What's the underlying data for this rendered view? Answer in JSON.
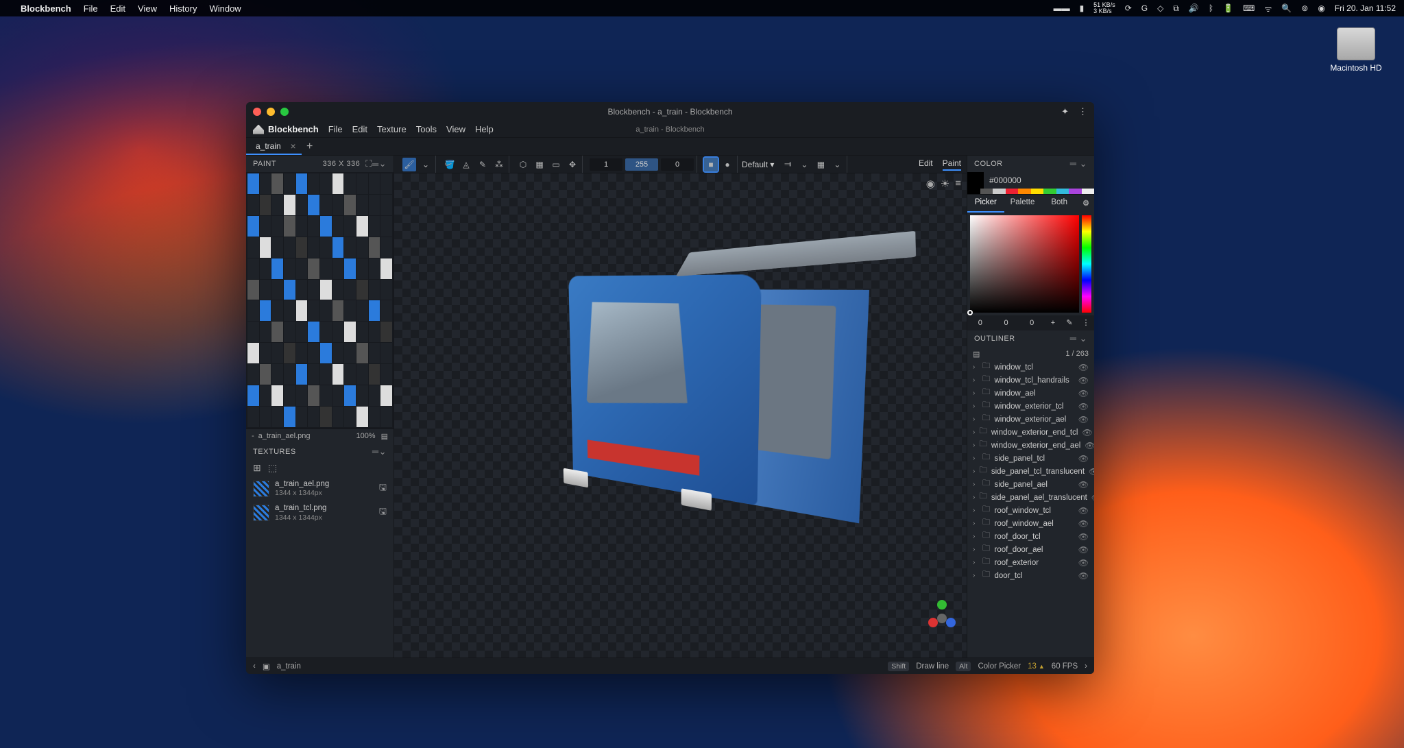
{
  "macos": {
    "app": "Blockbench",
    "menus": [
      "File",
      "Edit",
      "View",
      "History",
      "Window"
    ],
    "right_stats": {
      "net_up": "51 KB/s",
      "net_down": "3 KB/s"
    },
    "clock": "Fri 20. Jan  11:52"
  },
  "desktop_items": {
    "hd": "Macintosh HD"
  },
  "window": {
    "title": "Blockbench - a_train - Blockbench",
    "subtitle": "a_train - Blockbench",
    "menus": [
      "File",
      "Edit",
      "Texture",
      "Tools",
      "View",
      "Help"
    ]
  },
  "tabs": {
    "active": "a_train"
  },
  "paint_panel": {
    "title": "PAINT",
    "dimensions": "336 x 336",
    "uv_file": "a_train_ael.png",
    "zoom": "100%"
  },
  "textures": {
    "title": "TEXTURES",
    "items": [
      {
        "name": "a_train_ael.png",
        "dim": "1344 x 1344px"
      },
      {
        "name": "a_train_tcl.png",
        "dim": "1344 x 1344px"
      }
    ]
  },
  "toolbar": {
    "brush_vals": [
      "1",
      "255",
      "0"
    ],
    "shading": "Default"
  },
  "mode_tabs": {
    "edit": "Edit",
    "paint": "Paint"
  },
  "color_panel": {
    "title": "COLOR",
    "hex": "#000000",
    "tabs": [
      "Picker",
      "Palette",
      "Both"
    ],
    "rgb": [
      "0",
      "0",
      "0"
    ]
  },
  "outliner": {
    "title": "OUTLINER",
    "count": "1 / 263",
    "items": [
      "window_tcl",
      "window_tcl_handrails",
      "window_ael",
      "window_exterior_tcl",
      "window_exterior_ael",
      "window_exterior_end_tcl",
      "window_exterior_end_ael",
      "side_panel_tcl",
      "side_panel_tcl_translucent",
      "side_panel_ael",
      "side_panel_ael_translucent",
      "roof_window_tcl",
      "roof_window_ael",
      "roof_door_tcl",
      "roof_door_ael",
      "roof_exterior",
      "door_tcl"
    ]
  },
  "status": {
    "model_name": "a_train",
    "shift_action": "Draw line",
    "alt_action": "Color Picker",
    "warn_count": "13",
    "fps": "60 FPS"
  }
}
